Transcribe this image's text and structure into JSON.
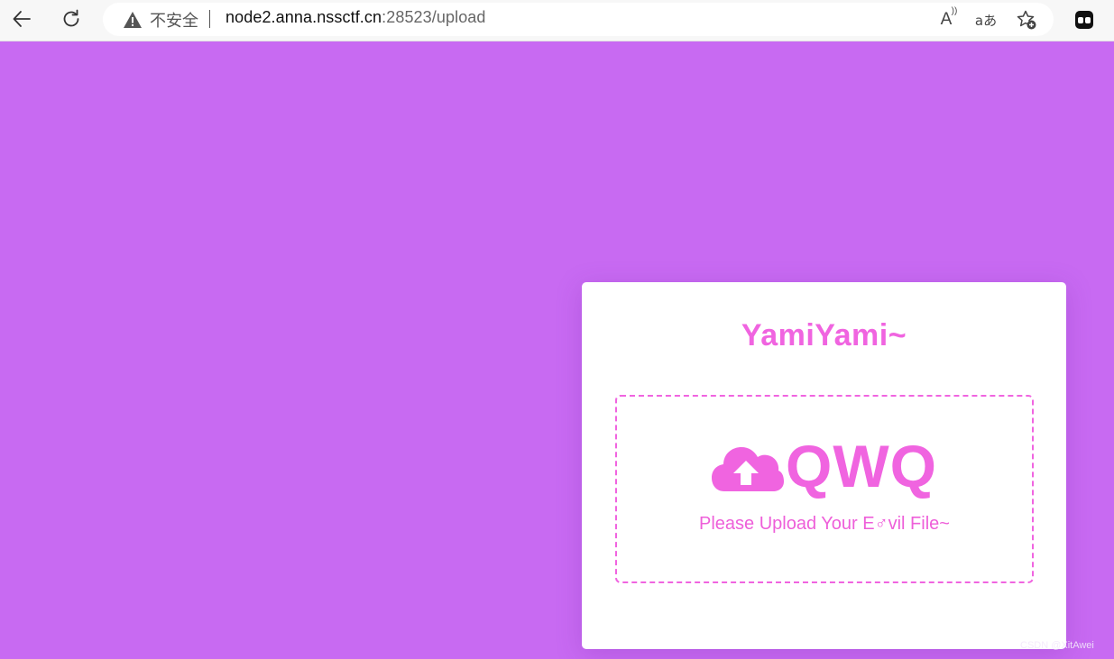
{
  "browser": {
    "security_label": "不安全",
    "url_host": "node2.anna.nssctf.cn",
    "url_rest": ":28523/upload",
    "read_aloud_label": "A",
    "translate_label": "aあ",
    "icons": [
      "back-icon",
      "refresh-icon",
      "warning-icon",
      "read-aloud-icon",
      "translate-icon",
      "add-favorite-icon",
      "extension-icon"
    ]
  },
  "page": {
    "title": "YamiYami~",
    "upload_heading": "QWQ",
    "upload_hint": "Please Upload Your E♂vil File~",
    "accent_color": "#f064e0",
    "background_color": "#c86af2"
  },
  "watermark": "CSDN @XitAwei"
}
